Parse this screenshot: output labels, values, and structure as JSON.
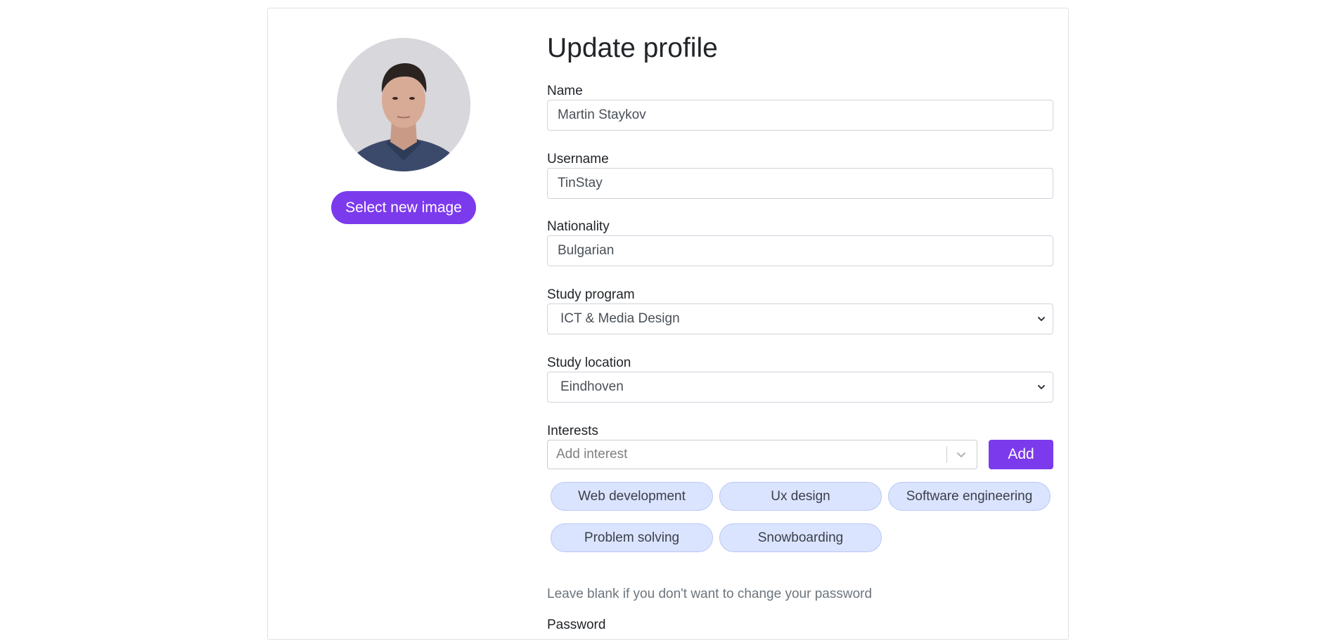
{
  "profile": {
    "select_image_label": "Select new image"
  },
  "form": {
    "title": "Update profile",
    "name": {
      "label": "Name",
      "value": "Martin Staykov"
    },
    "username": {
      "label": "Username",
      "value": "TinStay"
    },
    "nationality": {
      "label": "Nationality",
      "value": "Bulgarian"
    },
    "study_program": {
      "label": "Study program",
      "selected": "ICT & Media Design"
    },
    "study_location": {
      "label": "Study location",
      "selected": "Eindhoven"
    },
    "interests": {
      "label": "Interests",
      "placeholder": "Add interest",
      "add_label": "Add",
      "chips": [
        "Web development",
        "Ux design",
        "Software engineering",
        "Problem solving",
        "Snowboarding"
      ]
    },
    "password_hint": "Leave blank if you don't want to change your password",
    "password": {
      "label": "Password"
    }
  },
  "colors": {
    "accent": "#7c3aed",
    "chip_bg": "#dbe4fe"
  }
}
